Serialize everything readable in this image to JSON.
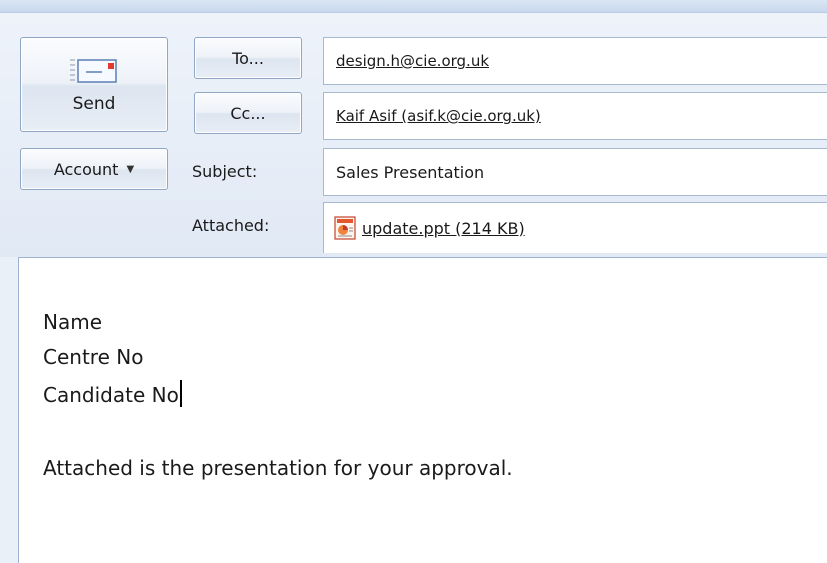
{
  "toolbar": {
    "send_label": "Send",
    "to_label": "To...",
    "cc_label": "Cc...",
    "account_label": "Account"
  },
  "fields": {
    "subject_label": "Subject:",
    "attached_label": "Attached:",
    "to_value": "design.h@cie.org.uk",
    "cc_value": "Kaif Asif (asif.k@cie.org.uk)",
    "subject_value": "Sales Presentation",
    "attachment": "update.ppt (214 KB)"
  },
  "body": {
    "lines": [
      "Name",
      "Centre No",
      "Candidate No",
      "Attached is the presentation for your approval."
    ]
  },
  "icons": {
    "send": "envelope-send-icon",
    "account_dropdown": "chevron-down-icon",
    "attachment": "powerpoint-file-icon"
  },
  "colors": {
    "header_bg": "#e1e9f5",
    "border": "#a7b8cf"
  }
}
